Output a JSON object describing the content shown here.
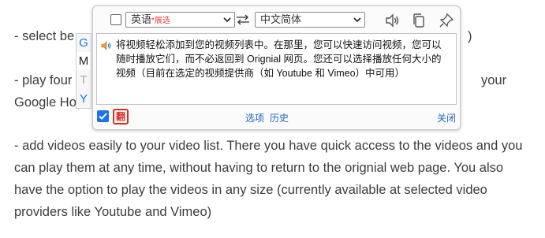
{
  "page": {
    "p1_visible": "- select be",
    "p1_right": ")",
    "p2_line1_left": "- play four",
    "p2_line1_right": "your",
    "p2_line2": "Google Ho",
    "p3": "- add videos easily to your video list. There you have quick access to the videos and you can play them at any time, without having to return to the orignial web page. You also have the option to play the videos in any size (currently available at selected video providers like Youtube and Vimeo)"
  },
  "popup": {
    "source_lang": "英语",
    "source_hint": "*展选",
    "target_lang": "中文简体",
    "translation": "将视频轻松添加到您的视频列表中。在那里，您可以快速访问视频，您可以随时播放它们，而不必返回到 Orignial 网页。您还可以选择播放任何大小的视频（目前在选定的视频提供商（如 Youtube 和 Vimeo）中可用）",
    "options_label": "选项",
    "history_label": "历史",
    "close_label": "关闭",
    "logo_text": "翻"
  },
  "side_tabs": [
    "G",
    "M",
    "T",
    "Y"
  ],
  "colors": {
    "accent": "#1a73e8",
    "brand_red": "#d93025",
    "link": "#2266bb"
  }
}
